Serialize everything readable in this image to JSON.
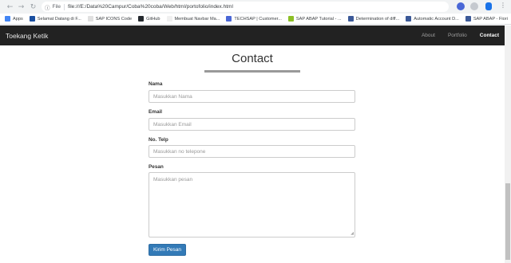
{
  "browser": {
    "omnibox_prefix": "File",
    "url": "file:///E:/Data%20Campur/Coba%20coba/Web/html/portofolio/index.html",
    "nav_back": "←",
    "nav_forward": "→",
    "nav_reload": "↻",
    "menu": "⋮"
  },
  "bookmarks": [
    {
      "label": "Apps",
      "color": "#4285f4"
    },
    {
      "label": "Selamat Datang di F...",
      "color": "#1a4fa0"
    },
    {
      "label": "SAP ICONS Code",
      "color": "#e0e0e0"
    },
    {
      "label": "GitHub",
      "color": "#24292e"
    },
    {
      "label": "Membuat Navbar Ma...",
      "color": "#f0f0f0"
    },
    {
      "label": "TECHSAP | Customer...",
      "color": "#4a67d6"
    },
    {
      "label": "SAP ABAP Tutorial - ...",
      "color": "#8cbf26"
    },
    {
      "label": "Determination of diff...",
      "color": "#3b5998"
    },
    {
      "label": "Automatic Account D...",
      "color": "#3b5998"
    },
    {
      "label": "SAP ABAP - Fiori",
      "color": "#3b5998"
    }
  ],
  "navbar": {
    "brand": "Toekang Ketik",
    "links": [
      "About",
      "Portfolio",
      "Contact"
    ],
    "active": "Contact"
  },
  "contact": {
    "title": "Contact",
    "name_label": "Nama",
    "name_placeholder": "Masukkan Nama",
    "email_label": "Email",
    "email_placeholder": "Masukkan Email",
    "phone_label": "No. Telp",
    "phone_placeholder": "Masukkan no telepone",
    "message_label": "Pesan",
    "message_placeholder": "Masukkan pesan",
    "submit_label": "Kirim Pesan"
  }
}
